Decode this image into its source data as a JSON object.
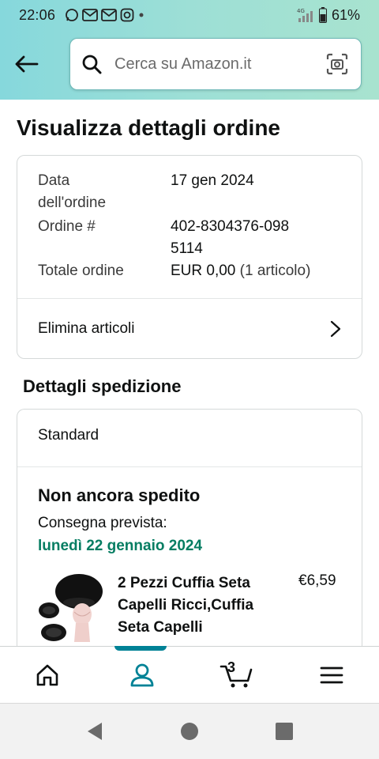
{
  "status_bar": {
    "time": "22:06",
    "network": "4G",
    "battery": "61%"
  },
  "header": {
    "search_placeholder": "Cerca su Amazon.it"
  },
  "page": {
    "title": "Visualizza dettagli ordine"
  },
  "order": {
    "date_label": "Data dell'ordine",
    "date_value": "17 gen 2024",
    "number_label": "Ordine #",
    "number_value": "402-8304376-0985114",
    "total_label": "Totale ordine",
    "total_value": "EUR 0,00",
    "total_items": "(1 articolo)",
    "delete_items_label": "Elimina articoli"
  },
  "shipping": {
    "section_title": "Dettagli spedizione",
    "type": "Standard",
    "status": "Non ancora spedito",
    "delivery_label": "Consegna prevista:",
    "delivery_date": "lunedì 22 gennaio 2024",
    "item": {
      "name": "2 Pezzi Cuffia Seta Capelli Ricci,Cuffia Seta Capelli",
      "price": "€6,59"
    }
  },
  "bottom_nav": {
    "cart_count": "3",
    "active": "account"
  },
  "colors": {
    "accent": "#008296",
    "delivery_green": "#067d62",
    "header_gradient_start": "#86d8dc",
    "header_gradient_end": "#a8e3cf"
  }
}
